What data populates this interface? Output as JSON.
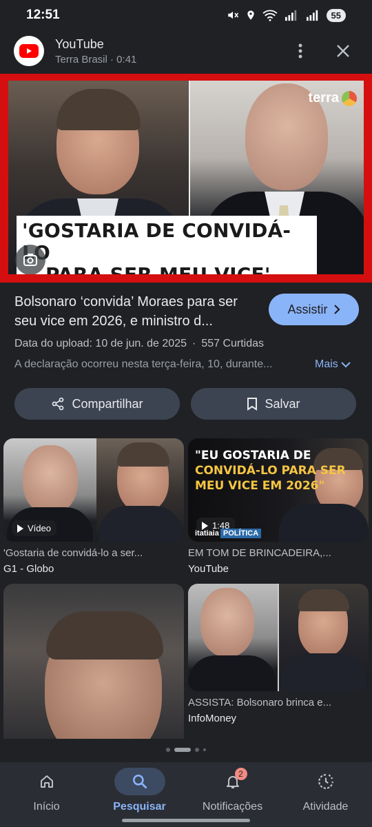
{
  "status": {
    "time": "12:51",
    "battery": "55"
  },
  "header": {
    "app_name": "YouTube",
    "subtitle": "Terra Brasil · 0:41"
  },
  "hero": {
    "caption_line1": "'GOSTARIA DE CONVIDÁ-LO",
    "caption_line2": "PARA SER MEU VICE'",
    "watermark": "terra"
  },
  "video": {
    "title": "Bolsonaro ‘convida’ Moraes para ser seu vice em 2026, e ministro d...",
    "watch_label": "Assistir",
    "upload_date": "Data do upload: 10 de jun. de 2025",
    "separator": "·",
    "likes": "557 Curtidas",
    "description": "A declaração ocorreu nesta terça-feira, 10, durante...",
    "more_label": "Mais"
  },
  "actions": {
    "share_label": "Compartilhar",
    "save_label": "Salvar"
  },
  "results": [
    {
      "title": "'Gostaria de convidá-lo a ser...",
      "source": "G1 - Globo",
      "badge": "Vídeo"
    },
    {
      "title": "EM TOM DE BRINCADEIRA,...",
      "source": "YouTube",
      "badge": "1:48",
      "overlay_line1": "\"EU GOSTARIA DE",
      "overlay_line2": "CONVIDÁ-LO PARA SER",
      "overlay_line3": "MEU VICE EM 2026\"",
      "channel": "itatiaia",
      "channel_tag": "POLÍTICA"
    },
    {
      "title": "",
      "source": ""
    },
    {
      "title": "ASSISTA: Bolsonaro brinca e...",
      "source": "InfoMoney"
    }
  ],
  "nav": {
    "home": "Início",
    "search": "Pesquisar",
    "notifications": "Notificações",
    "notifications_count": "2",
    "activity": "Atividade"
  },
  "colors": {
    "accent": "#8ab4f8",
    "frame": "#d50f0f",
    "background": "#202124"
  }
}
